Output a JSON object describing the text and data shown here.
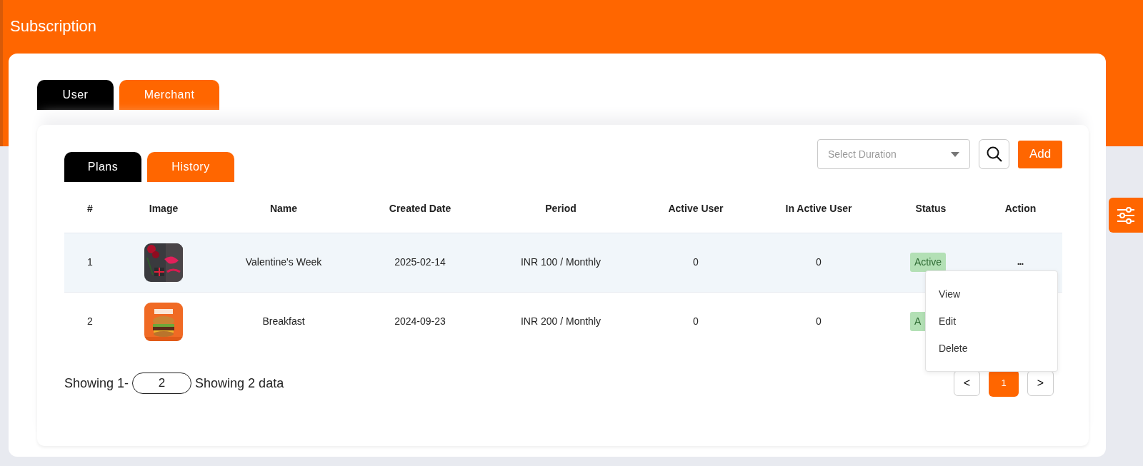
{
  "header": {
    "title": "Subscription"
  },
  "main_tabs": [
    {
      "label": "User",
      "selected": true
    },
    {
      "label": "Merchant",
      "selected": false
    }
  ],
  "sub_tabs": [
    {
      "label": "Plans",
      "selected": true
    },
    {
      "label": "History",
      "selected": false
    }
  ],
  "toolbar": {
    "duration_select": {
      "placeholder": "Select Duration"
    },
    "add_button": "Add"
  },
  "table": {
    "columns": [
      "#",
      "Image",
      "Name",
      "Created Date",
      "Period",
      "Active User",
      "In Active User",
      "Status",
      "Action"
    ],
    "rows": [
      {
        "index": "1",
        "name": "Valentine's Week",
        "created_date": "2025-02-14",
        "period": "INR 100 / Monthly",
        "active_user": "0",
        "in_active_user": "0",
        "status": "Active",
        "action": "•••",
        "selected": true
      },
      {
        "index": "2",
        "name": "Breakfast",
        "created_date": "2024-09-23",
        "period": "INR 200 / Monthly",
        "active_user": "0",
        "in_active_user": "0",
        "status": "A",
        "action": "",
        "selected": false
      }
    ],
    "action_menu": {
      "open": true,
      "items": [
        "View",
        "Edit",
        "Delete"
      ]
    }
  },
  "footer": {
    "showing_prefix": "Showing 1-",
    "page_size": "2",
    "showing_suffix": "Showing 2 data"
  },
  "pagination": {
    "prev": "<",
    "pages": [
      {
        "label": "1",
        "selected": true
      }
    ],
    "next": ">"
  }
}
